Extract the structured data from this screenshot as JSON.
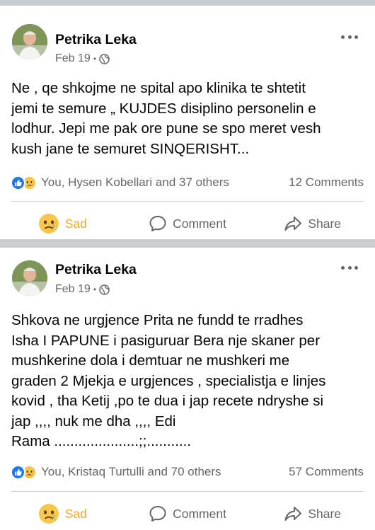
{
  "posts": [
    {
      "author": "Petrika Leka",
      "date": "Feb 19",
      "dot": "•",
      "text": "Ne , qe shkojme ne spital apo klinika te shtetit\njemi te semure „ KUJDES disiplino personelin  e\nlodhur. Jepi me pak ore pune  se spo meret vesh\nkush jane te semuret  SINQERISHT...",
      "reactions_text": "You, Hysen Kobellari and 37 others",
      "comments_text": "12 Comments",
      "actions": {
        "sad": "Sad",
        "comment": "Comment",
        "share": "Share"
      }
    },
    {
      "author": "Petrika Leka",
      "date": "Feb 19",
      "dot": "•",
      "text": "Shkova ne urgjence   Prita ne fundd  te rradhes\nIsha I PAPUNE  i pasiguruar Bera nje skaner  per\nmushkerine   dola i demtuar ne mushkeri   me\ngraden 2 Mjekja e urgjences  , specialistja e linjes\nkovid  , tha Ketij ,po te dua i jap recete  ndryshe si\njap ,,,, nuk me dha   ,,,, Edi\nRama .....................;;...........",
      "reactions_text": "You, Kristaq Turtulli and 70 others",
      "comments_text": "57 Comments",
      "actions": {
        "sad": "Sad",
        "comment": "Comment",
        "share": "Share"
      }
    }
  ],
  "colors": {
    "separator": "#c9ccd1",
    "secondary_text": "#65676b",
    "like_blue": "#1877f2",
    "sad_yellow": "#f7b125",
    "sad_label": "#f0a81d"
  },
  "icons": [
    "more-options-icon",
    "globe-icon",
    "like-reaction-icon",
    "sad-reaction-icon",
    "comment-icon",
    "share-icon"
  ]
}
